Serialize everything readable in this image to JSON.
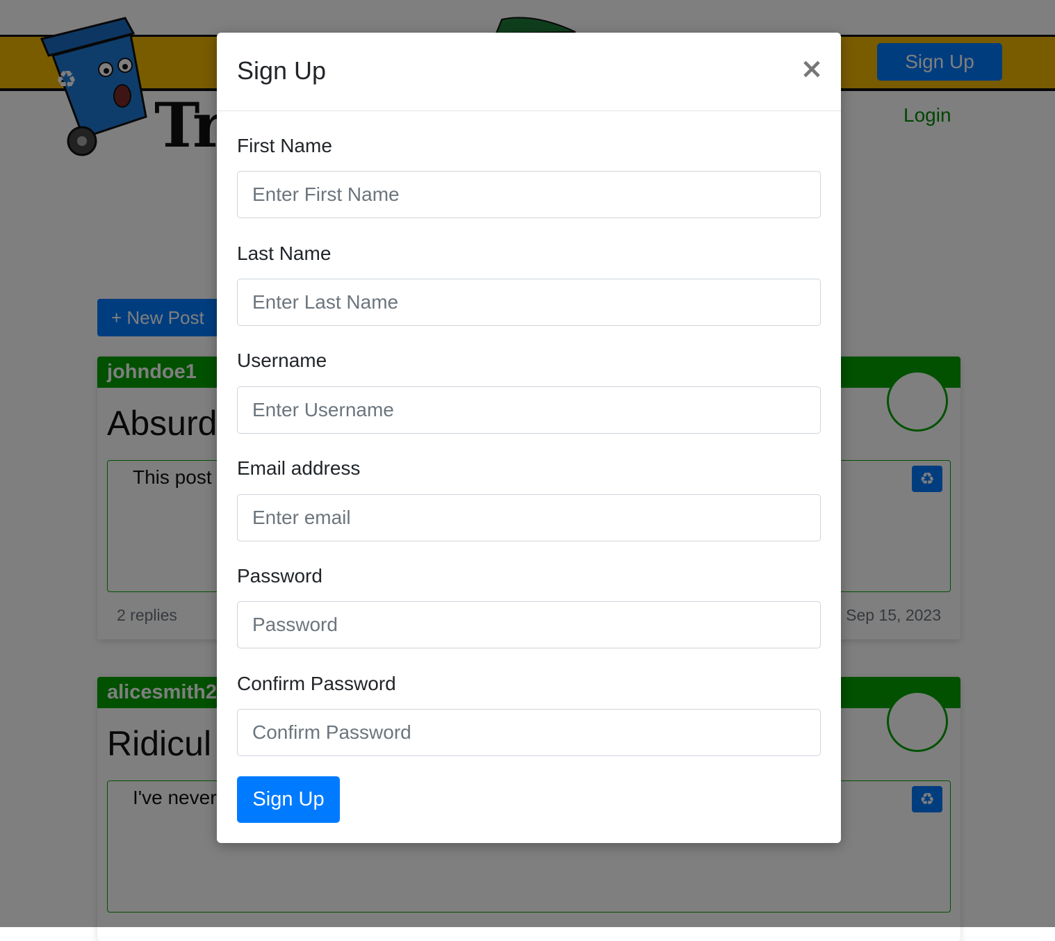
{
  "header": {
    "signup_label": "Sign Up",
    "login_label": "Login",
    "logo_text": "Tr"
  },
  "actions": {
    "new_post_label": "+ New Post"
  },
  "posts": [
    {
      "username": "johndoe1",
      "title": "Absurd",
      "body": "This post",
      "replies": "2 replies",
      "date": "Sep 15, 2023"
    },
    {
      "username": "alicesmith2",
      "title": "Ridicul",
      "body": "I've never"
    }
  ],
  "modal": {
    "title": "Sign Up",
    "close_symbol": "×",
    "fields": [
      {
        "label": "First Name",
        "placeholder": "Enter First Name"
      },
      {
        "label": "Last Name",
        "placeholder": "Enter Last Name"
      },
      {
        "label": "Username",
        "placeholder": "Enter Username"
      },
      {
        "label": "Email address",
        "placeholder": "Enter email"
      },
      {
        "label": "Password",
        "placeholder": "Password"
      },
      {
        "label": "Confirm Password",
        "placeholder": "Confirm Password"
      }
    ],
    "submit_label": "Sign Up"
  },
  "colors": {
    "primary": "#007bff",
    "header_bar": "#f2b600",
    "post_accent": "#02a202",
    "overlay": "rgba(0,0,0,0.5)"
  },
  "icons": {
    "recycle": "recycle-icon",
    "close": "close-icon"
  }
}
